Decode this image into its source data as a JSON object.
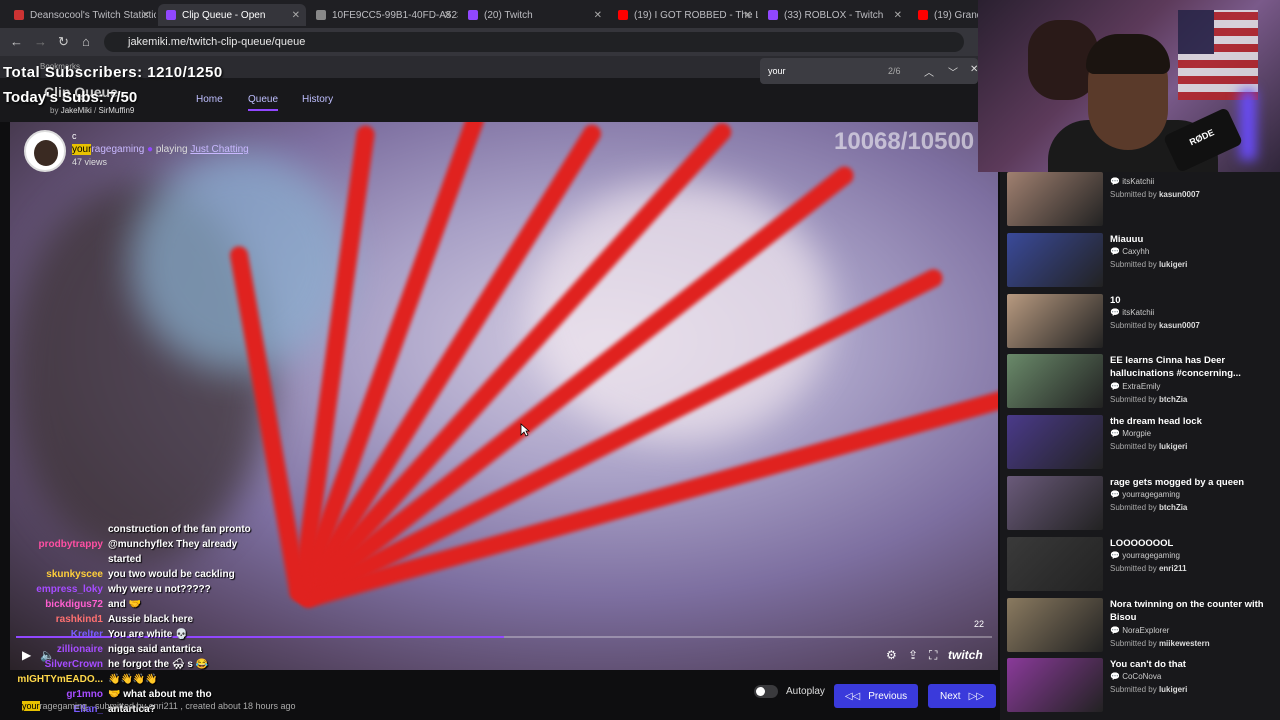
{
  "browser": {
    "tabs": [
      {
        "label": "Deansocool's Twitch Statistic",
        "color": "#c33"
      },
      {
        "label": "Clip Queue - Open",
        "color": "#9147ff"
      },
      {
        "label": "10FE9CC5-99B1-40FD-A523",
        "color": "#888"
      },
      {
        "label": "(20) Twitch",
        "color": "#9147ff"
      },
      {
        "label": "(19) I GOT ROBBED - The Lon",
        "color": "#f00"
      },
      {
        "label": "(33) ROBLOX - Twitch",
        "color": "#9147ff"
      },
      {
        "label": "(19) Grand T",
        "color": "#f00"
      }
    ],
    "url": "jakemiki.me/twitch-clip-queue/queue",
    "bookmarks_label": "Bookmarks",
    "find": {
      "query": "your",
      "count": "2/6"
    }
  },
  "overlay": {
    "total_subs": "Total Subscribers: 1210/1250",
    "today_subs": "Today's Subs: 7/50",
    "goal_counter": "10068/10500"
  },
  "header": {
    "brand": "Clip Queue",
    "by": "by",
    "author1": "JakeMiki",
    "author2": "SirMuffin9",
    "nav": [
      "Home",
      "Queue",
      "History"
    ]
  },
  "clip": {
    "letter": "c",
    "channel_highlight": "your",
    "channel_rest": "ragegaming",
    "playing": "playing",
    "game": "Just Chatting",
    "views": "47 views",
    "timecode": "22",
    "progress": 0.5,
    "logo": "twitch"
  },
  "chat": [
    {
      "user": "",
      "text": "construction of the fan pronto",
      "color": "#fff"
    },
    {
      "user": "prodbytrappy",
      "text": "@munchyflex They already",
      "color": "#ff4fa3"
    },
    {
      "user": "",
      "text": "started",
      "color": "#fff"
    },
    {
      "user": "skunkyscee",
      "text": "you two would be cackling",
      "color": "#ffcf3a"
    },
    {
      "user": "empress_loky",
      "text": "why were u not?????",
      "color": "#a64cff"
    },
    {
      "user": "bickdigus72",
      "text": "and 🤝",
      "color": "#ff5fd0"
    },
    {
      "user": "rashkind1",
      "text": "Aussie black here",
      "color": "#ff7070"
    },
    {
      "user": "Krelter",
      "text": "You are white 💀",
      "color": "#7a5cff"
    },
    {
      "user": "zillionaire",
      "text": "nigga said antartica",
      "color": "#a64cff"
    },
    {
      "user": "SilverCrown",
      "text": "he forgot the 🌨 s 😂",
      "color": "#a64cff"
    },
    {
      "user": "mIGHTYmEADO...",
      "text": "👋👋👋👋",
      "color": "#ffd84a"
    },
    {
      "user": "gr1mno",
      "text": "🤝 what about me tho",
      "color": "#a64cff"
    },
    {
      "user": "Ellan_",
      "text": "antartica?",
      "color": "#7a5cff"
    }
  ],
  "footer": {
    "submitted_highlight": "your",
    "submitted_rest": "ragegaming · submitted by enri211 , created about 18 hours ago",
    "autoplay": "Autoplay",
    "previous": "Previous",
    "next": "Next"
  },
  "queue": [
    {
      "title": "",
      "channel": "itsKatchii",
      "submitter": "kasun0007",
      "thumb": "#a08070"
    },
    {
      "title": "Miauuu",
      "channel": "Caxyhh",
      "submitter": "lukigeri",
      "thumb": "#3a4a9a"
    },
    {
      "title": "10",
      "channel": "itsKatchii",
      "submitter": "kasun0007",
      "thumb": "#b89a80"
    },
    {
      "title": "EE learns Cinna has Deer hallucinations #concerning...",
      "channel": "ExtraEmily",
      "submitter": "btchZia",
      "thumb": "#6a8a6a"
    },
    {
      "title": "the dream head lock",
      "channel": "Morgpie",
      "submitter": "lukigeri",
      "thumb": "#4a3a8a"
    },
    {
      "title": "rage gets mogged by a queen",
      "channel": "yourragegaming",
      "submitter": "btchZia",
      "thumb": "#6a5a7a"
    },
    {
      "title": "LOOOOOOOL",
      "channel": "yourragegaming",
      "submitter": "enri211",
      "thumb": "#3a3a3a"
    },
    {
      "title": "Nora twinning on the counter with Bisou",
      "channel": "NoraExplorer",
      "submitter": "miikewestern",
      "thumb": "#8a7a60"
    },
    {
      "title": "You can't do that",
      "channel": "CoCoNova",
      "submitter": "lukigeri",
      "thumb": "#8a3a9a"
    }
  ],
  "queue_submitted_prefix": "Submitted by",
  "webcam": {
    "mic_brand": "RØDE"
  }
}
